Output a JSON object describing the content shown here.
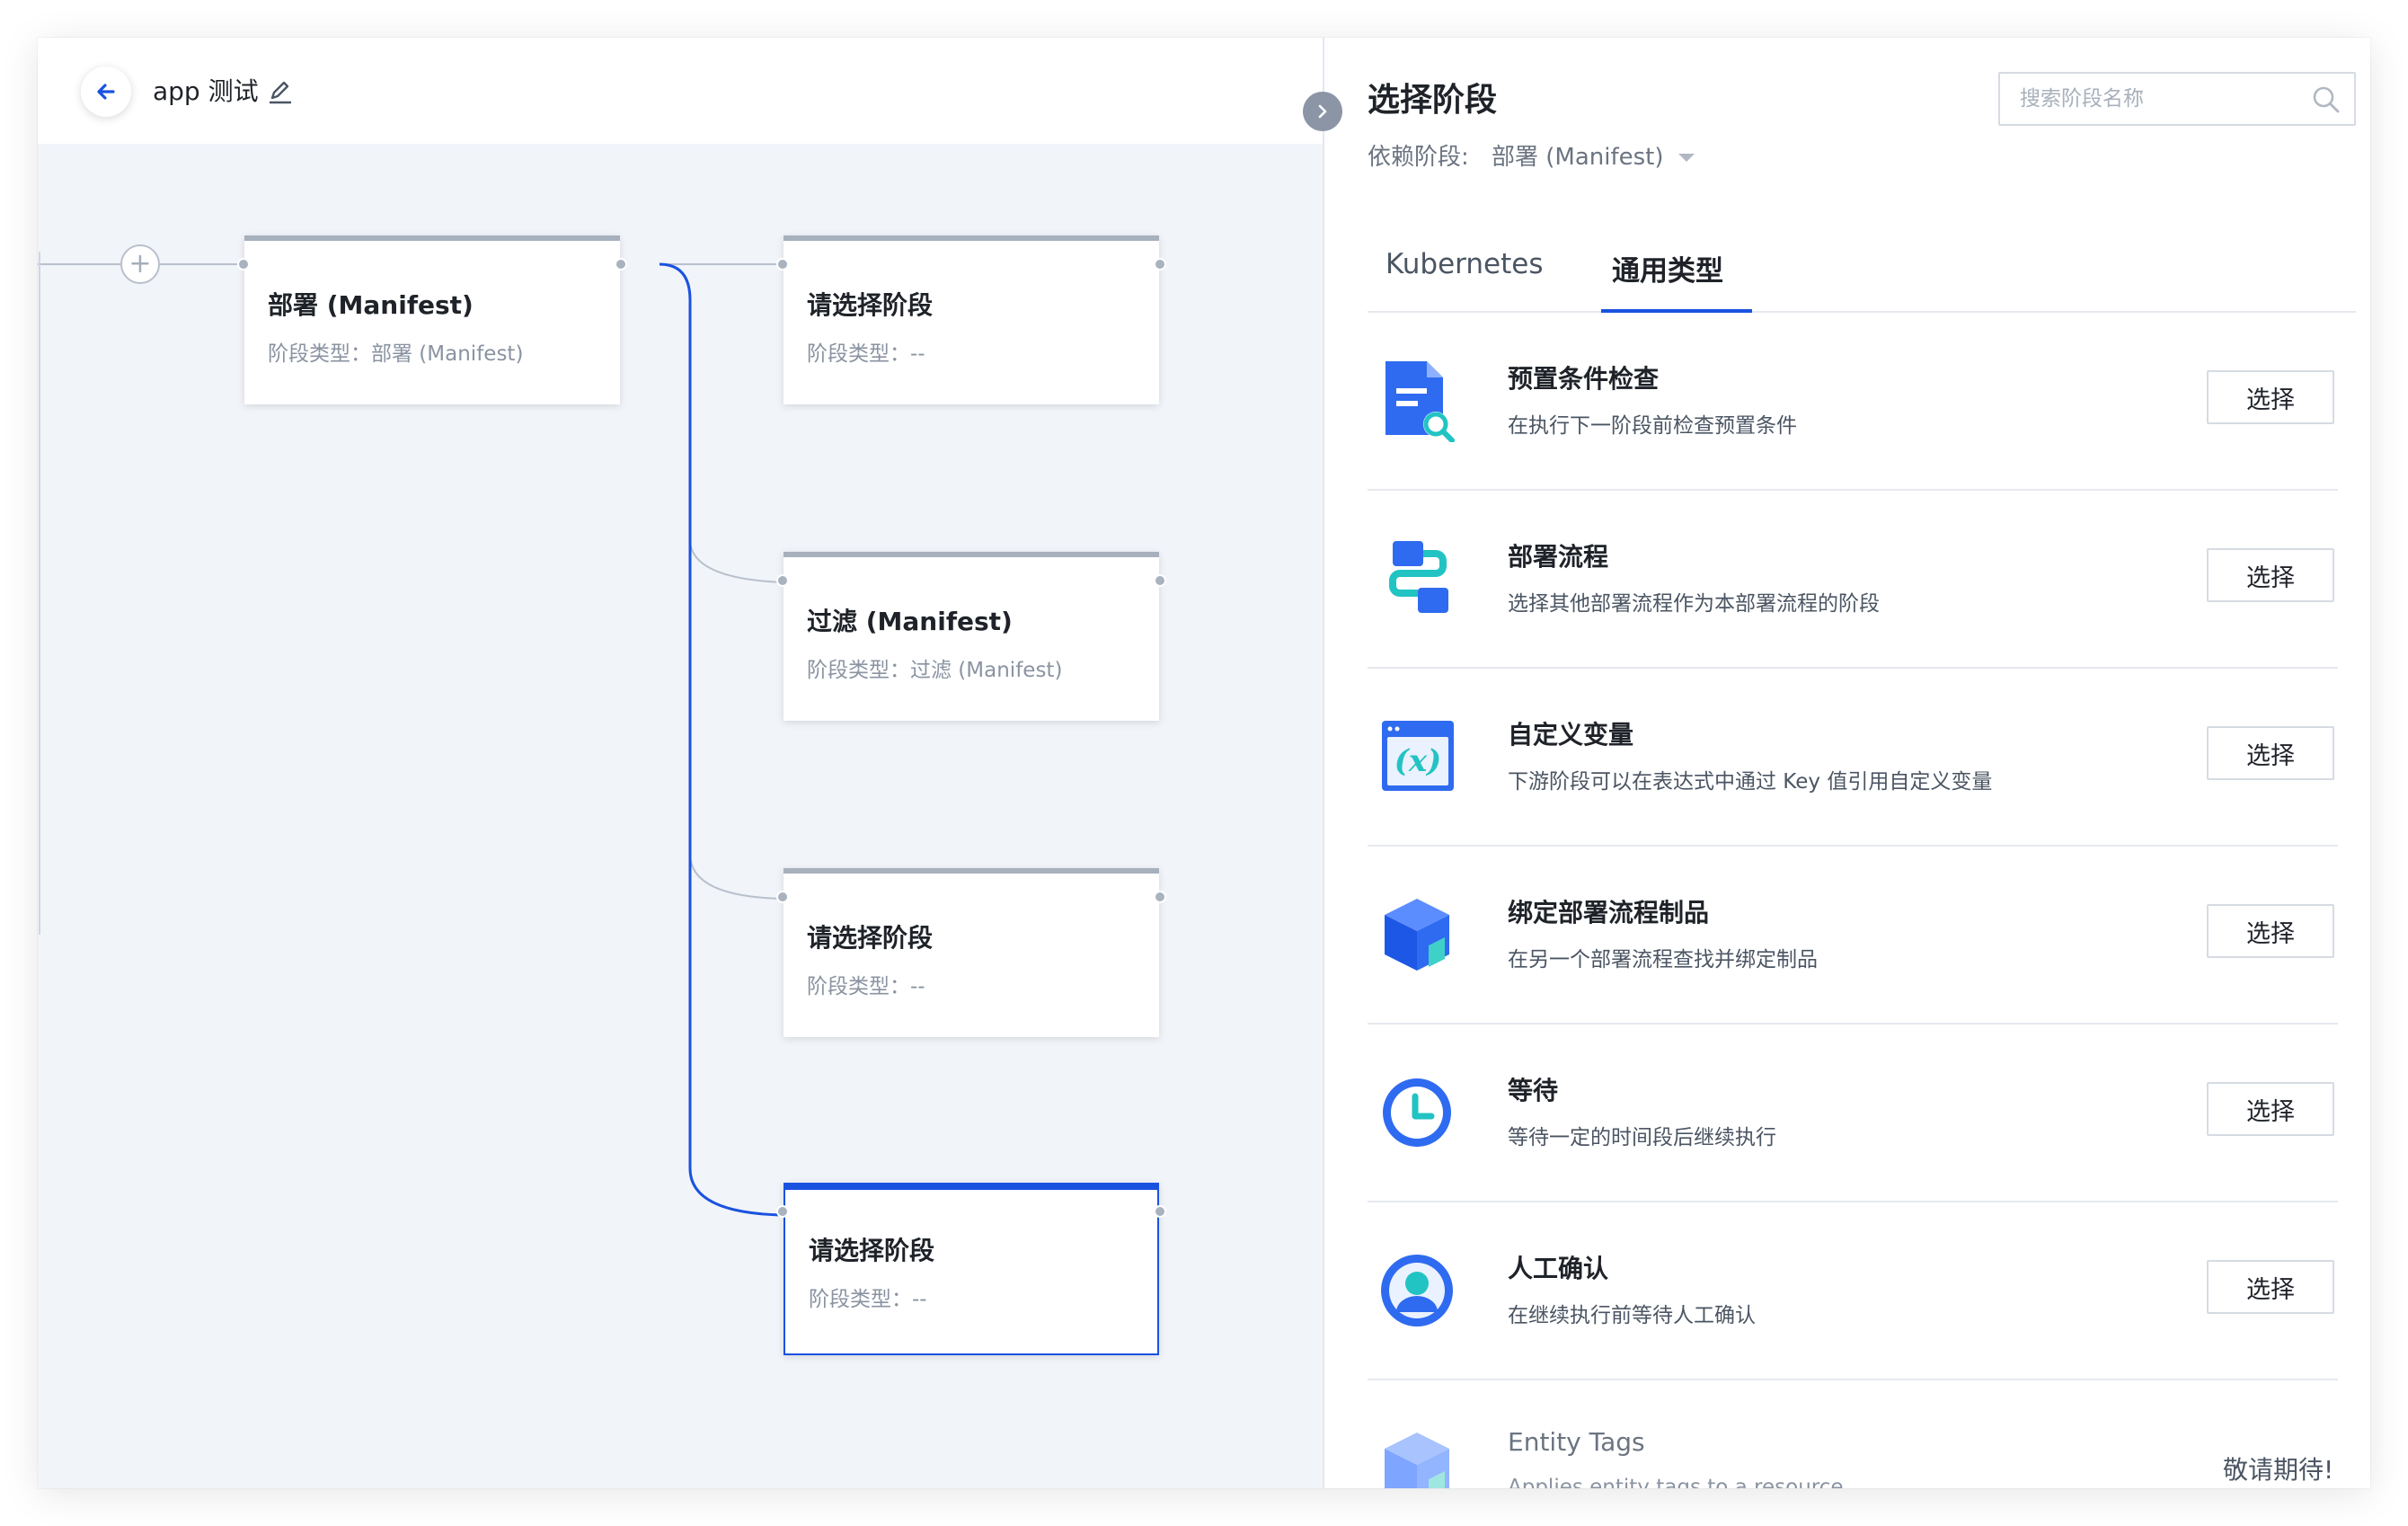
{
  "header": {
    "app_title": "app 测试"
  },
  "canvas": {
    "nodes": [
      {
        "title": "部署 (Manifest)",
        "type_label": "阶段类型：部署 (Manifest)"
      },
      {
        "title": "请选择阶段",
        "type_label": "阶段类型：--"
      },
      {
        "title": "过滤 (Manifest)",
        "type_label": "阶段类型：过滤 (Manifest)"
      },
      {
        "title": "请选择阶段",
        "type_label": "阶段类型：--"
      },
      {
        "title": "请选择阶段",
        "type_label": "阶段类型：--"
      }
    ]
  },
  "panel": {
    "title": "选择阶段",
    "search_placeholder": "搜索阶段名称",
    "dependency_label": "依赖阶段:",
    "dependency_value": "部署 (Manifest)",
    "tabs": [
      {
        "label": "Kubernetes"
      },
      {
        "label": "通用类型"
      }
    ],
    "active_tab": "通用类型",
    "items": [
      {
        "name": "预置条件检查",
        "desc": "在执行下一阶段前检查预置条件",
        "action": "选择",
        "icon": "document-search-icon"
      },
      {
        "name": "部署流程",
        "desc": "选择其他部署流程作为本部署流程的阶段",
        "action": "选择",
        "icon": "flow-icon"
      },
      {
        "name": "自定义变量",
        "desc": "下游阶段可以在表达式中通过 Key 值引用自定义变量",
        "action": "选择",
        "icon": "variable-icon"
      },
      {
        "name": "绑定部署流程制品",
        "desc": "在另一个部署流程查找并绑定制品",
        "action": "选择",
        "icon": "cube-icon"
      },
      {
        "name": "等待",
        "desc": "等待一定的时间段后继续执行",
        "action": "选择",
        "icon": "clock-icon"
      },
      {
        "name": "人工确认",
        "desc": "在继续执行前等待人工确认",
        "action": "选择",
        "icon": "user-icon"
      },
      {
        "name": "Entity Tags",
        "desc": "Applies entity tags to a resource.",
        "action": "敬请期待!",
        "icon": "cube-tag-icon"
      }
    ]
  },
  "colors": {
    "accent": "#1a52e0",
    "canvas_bg": "#f1f4f9"
  }
}
